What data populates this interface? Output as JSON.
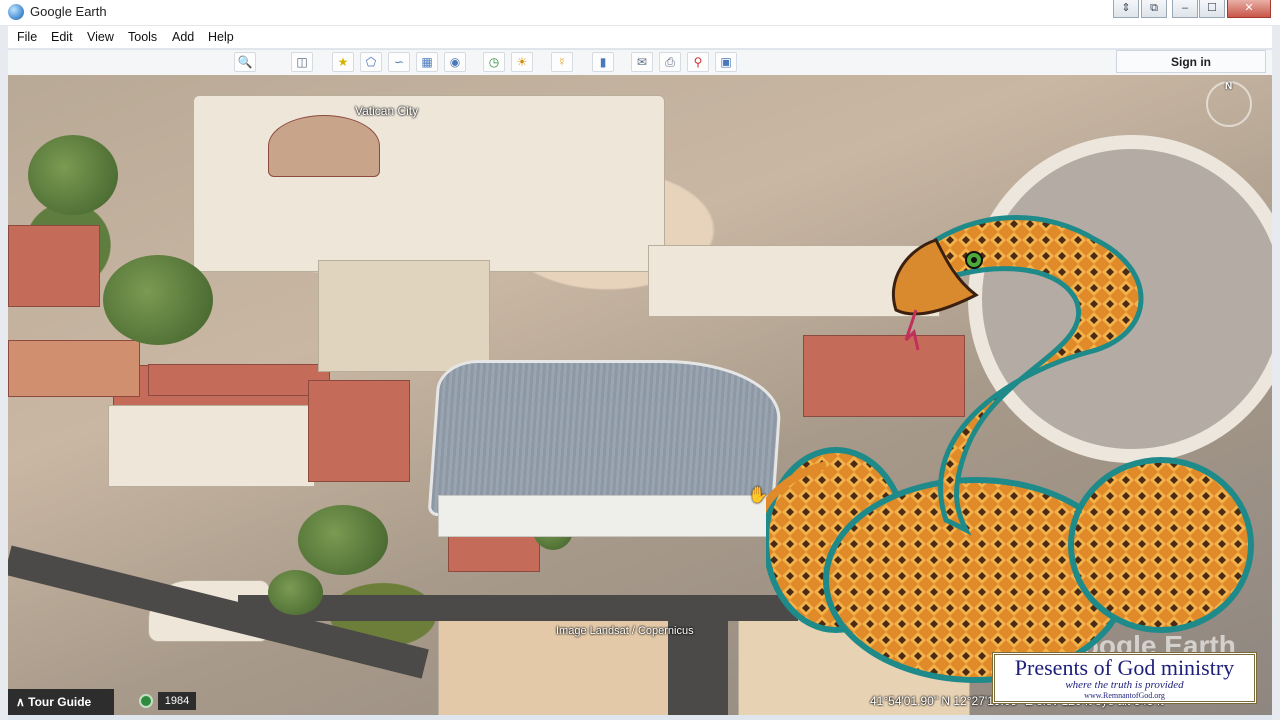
{
  "window": {
    "title": "Google Earth",
    "controls": [
      "⇕",
      "⧉",
      "–",
      "☐",
      "✕"
    ]
  },
  "menu": {
    "items": [
      {
        "label": "File"
      },
      {
        "label": "Edit"
      },
      {
        "label": "View"
      },
      {
        "label": "Tools"
      },
      {
        "label": "Add"
      },
      {
        "label": "Help"
      }
    ]
  },
  "toolbar": {
    "icons": [
      "search-icon",
      "sidebar-icon",
      "placemark-icon",
      "polygon-icon",
      "path-icon",
      "image-overlay-icon",
      "record-tour-icon",
      "historical-imagery-icon",
      "sunlight-icon",
      "planets-icon",
      "ruler-icon",
      "email-icon",
      "print-icon",
      "view-in-maps-icon",
      "save-image-icon"
    ],
    "sign_in_label": "Sign in"
  },
  "map": {
    "place_label": "Vatican City",
    "imagery_credit": "Image Landsat / Copernicus",
    "watermark": "Google Earth",
    "compass_north": "N"
  },
  "status": {
    "tour_guide_label": "Tour Guide",
    "imagery_year": "1984",
    "coordinates_text": "41°54'01.90\" N   12°27'19.09\" E   elev  120 ft   eye alt  645 ft"
  },
  "overlay_logo": {
    "title": "Presents of God ministry",
    "tagline": "where the truth is provided",
    "url": "www.RemnantofGod.org"
  }
}
